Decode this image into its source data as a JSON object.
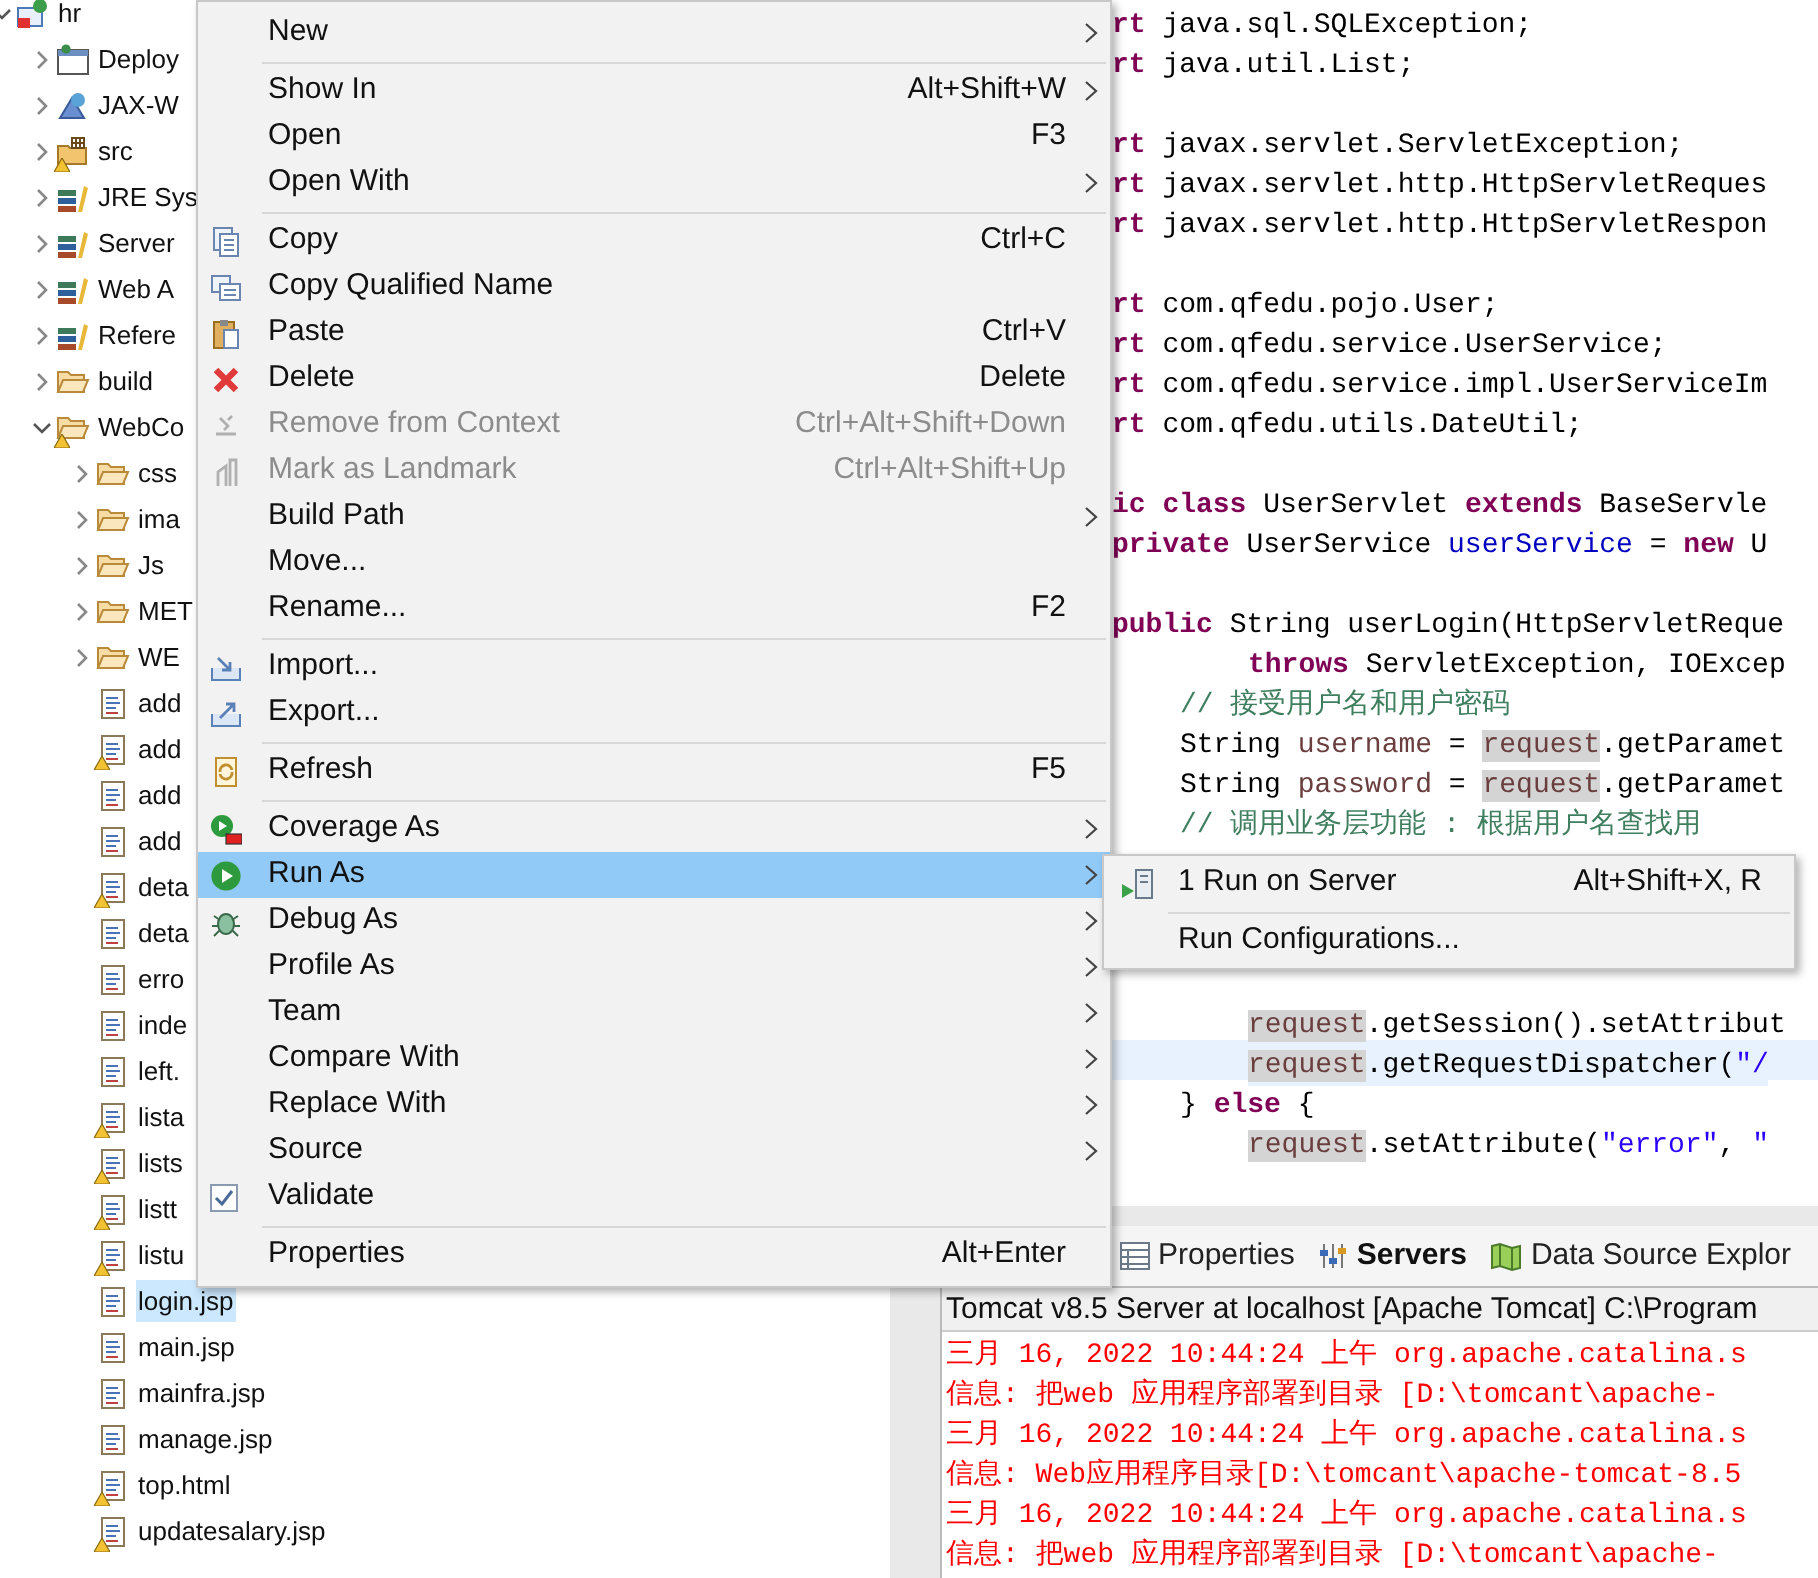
{
  "tree": {
    "items": [
      {
        "label": "hr",
        "kind": "project",
        "expanded": true,
        "selected": false,
        "children": [
          {
            "label": "Deploy",
            "kind": "deploy",
            "expanded": false,
            "selected": false
          },
          {
            "label": "JAX-W",
            "kind": "jaxws",
            "expanded": false,
            "selected": false
          },
          {
            "label": "src",
            "kind": "source-folder",
            "expanded": false,
            "warning": true,
            "selected": false
          },
          {
            "label": "JRE Sys",
            "kind": "library",
            "expanded": false,
            "selected": false
          },
          {
            "label": "Server",
            "kind": "library",
            "expanded": false,
            "selected": false
          },
          {
            "label": "Web A",
            "kind": "library",
            "expanded": false,
            "selected": false
          },
          {
            "label": "Refere",
            "kind": "library",
            "expanded": false,
            "selected": false
          },
          {
            "label": "build",
            "kind": "folder",
            "expanded": false,
            "selected": false
          },
          {
            "label": "WebCo",
            "kind": "folder",
            "expanded": true,
            "warning": true,
            "selected": false,
            "children": [
              {
                "label": "css",
                "kind": "folder",
                "expanded": false,
                "selected": false
              },
              {
                "label": "ima",
                "kind": "folder",
                "expanded": false,
                "selected": false
              },
              {
                "label": "Js",
                "kind": "folder",
                "expanded": false,
                "selected": false
              },
              {
                "label": "MET",
                "kind": "folder",
                "expanded": false,
                "selected": false
              },
              {
                "label": "WE",
                "kind": "folder",
                "expanded": false,
                "selected": false
              },
              {
                "label": "add",
                "kind": "file",
                "selected": false
              },
              {
                "label": "add",
                "kind": "file",
                "warning": true,
                "selected": false
              },
              {
                "label": "add",
                "kind": "file",
                "selected": false
              },
              {
                "label": "add",
                "kind": "file",
                "selected": false
              },
              {
                "label": "deta",
                "kind": "file",
                "warning": true,
                "selected": false
              },
              {
                "label": "deta",
                "kind": "file",
                "selected": false
              },
              {
                "label": "erro",
                "kind": "file",
                "selected": false
              },
              {
                "label": "inde",
                "kind": "file",
                "selected": false
              },
              {
                "label": "left.",
                "kind": "file",
                "selected": false
              },
              {
                "label": "lista",
                "kind": "file",
                "warning": true,
                "selected": false
              },
              {
                "label": "lists",
                "kind": "file",
                "warning": true,
                "selected": false
              },
              {
                "label": "listt",
                "kind": "file",
                "warning": true,
                "selected": false
              },
              {
                "label": "listu",
                "kind": "file",
                "warning": true,
                "selected": false
              },
              {
                "label": "login.jsp",
                "kind": "file",
                "selected": true
              },
              {
                "label": "main.jsp",
                "kind": "file",
                "selected": false
              },
              {
                "label": "mainfra.jsp",
                "kind": "file",
                "selected": false
              },
              {
                "label": "manage.jsp",
                "kind": "file",
                "selected": false
              },
              {
                "label": "top.html",
                "kind": "file",
                "warning": true,
                "selected": false
              },
              {
                "label": "updatesalary.jsp",
                "kind": "file",
                "warning": true,
                "selected": false
              }
            ]
          }
        ]
      }
    ]
  },
  "editor": {
    "lines": [
      {
        "kind": "code0",
        "current": false,
        "segments": [
          {
            "kind": "keyword",
            "text": "rt"
          },
          {
            "kind": "plain",
            "text": " java.sql.SQLException;"
          }
        ]
      },
      {
        "kind": "code0",
        "current": false,
        "segments": [
          {
            "kind": "keyword",
            "text": "rt"
          },
          {
            "kind": "plain",
            "text": " java.util.List;"
          }
        ]
      },
      {
        "kind": "blank"
      },
      {
        "kind": "code0",
        "current": false,
        "segments": [
          {
            "kind": "keyword",
            "text": "rt"
          },
          {
            "kind": "plain",
            "text": " javax.servlet.ServletException;"
          }
        ]
      },
      {
        "kind": "code0",
        "current": false,
        "segments": [
          {
            "kind": "keyword",
            "text": "rt"
          },
          {
            "kind": "plain",
            "text": " javax.servlet.http.HttpServletReques"
          }
        ]
      },
      {
        "kind": "code0",
        "current": false,
        "segments": [
          {
            "kind": "keyword",
            "text": "rt"
          },
          {
            "kind": "plain",
            "text": " javax.servlet.http.HttpServletRespon"
          }
        ]
      },
      {
        "kind": "blank"
      },
      {
        "kind": "code0",
        "current": false,
        "segments": [
          {
            "kind": "keyword",
            "text": "rt"
          },
          {
            "kind": "plain",
            "text": " com.qfedu.pojo.User;"
          }
        ]
      },
      {
        "kind": "code0",
        "current": false,
        "segments": [
          {
            "kind": "keyword",
            "text": "rt"
          },
          {
            "kind": "plain",
            "text": " com.qfedu.service.UserService;"
          }
        ]
      },
      {
        "kind": "code0",
        "current": false,
        "segments": [
          {
            "kind": "keyword",
            "text": "rt"
          },
          {
            "kind": "plain",
            "text": " com.qfedu.service.impl.UserServiceIm"
          }
        ]
      },
      {
        "kind": "code0",
        "current": false,
        "segments": [
          {
            "kind": "keyword",
            "text": "rt"
          },
          {
            "kind": "plain",
            "text": " com.qfedu.utils.DateUtil;"
          }
        ]
      },
      {
        "kind": "blank"
      },
      {
        "kind": "code0",
        "current": false,
        "segments": [
          {
            "kind": "keyword",
            "text": "ic class"
          },
          {
            "kind": "plain",
            "text": " UserServlet "
          },
          {
            "kind": "keyword",
            "text": "extends"
          },
          {
            "kind": "plain",
            "text": " BaseServle"
          }
        ]
      },
      {
        "kind": "code0",
        "current": false,
        "segments": [
          {
            "kind": "keyword",
            "text": "private"
          },
          {
            "kind": "plain",
            "text": " UserService "
          },
          {
            "kind": "field",
            "text": "userService"
          },
          {
            "kind": "plain",
            "text": " = "
          },
          {
            "kind": "keyword",
            "text": "new"
          },
          {
            "kind": "plain",
            "text": " U"
          }
        ]
      },
      {
        "kind": "blank"
      },
      {
        "kind": "code0",
        "current": false,
        "segments": [
          {
            "kind": "keyword",
            "text": "public"
          },
          {
            "kind": "plain",
            "text": " String userLogin(HttpServletReque"
          }
        ]
      },
      {
        "kind": "code2",
        "current": false,
        "segments": [
          {
            "kind": "keyword",
            "text": "throws"
          },
          {
            "kind": "plain",
            "text": " ServletException, IOExcep"
          }
        ]
      },
      {
        "kind": "code1",
        "current": false,
        "segments": [
          {
            "kind": "comment",
            "text": "// 接受用户名和用户密码"
          }
        ]
      },
      {
        "kind": "code1",
        "current": false,
        "segments": [
          {
            "kind": "plain",
            "text": "String "
          },
          {
            "kind": "local",
            "text": "username"
          },
          {
            "kind": "plain",
            "text": " = "
          },
          {
            "kind": "occurrence",
            "text": "request"
          },
          {
            "kind": "plain",
            "text": ".getParamet"
          }
        ]
      },
      {
        "kind": "code1",
        "current": false,
        "segments": [
          {
            "kind": "plain",
            "text": "String "
          },
          {
            "kind": "local",
            "text": "password"
          },
          {
            "kind": "plain",
            "text": " = "
          },
          {
            "kind": "occurrence",
            "text": "request"
          },
          {
            "kind": "plain",
            "text": ".getParamet"
          }
        ]
      },
      {
        "kind": "code1",
        "current": false,
        "segments": [
          {
            "kind": "comment",
            "text": "// 调用业务层功能 : 根据用户名查找用"
          }
        ]
      },
      {
        "kind": "blank"
      },
      {
        "kind": "blank"
      },
      {
        "kind": "blank"
      },
      {
        "kind": "blank"
      },
      {
        "kind": "code2",
        "current": false,
        "segments": [
          {
            "kind": "occurrence",
            "text": "request"
          },
          {
            "kind": "plain",
            "text": ".getSession().setAttribut"
          }
        ]
      },
      {
        "kind": "code2",
        "current": true,
        "segments": [
          {
            "kind": "occurrence",
            "text": "request"
          },
          {
            "kind": "plain",
            "text": ".getRequestDispatcher("
          },
          {
            "kind": "string",
            "text": "\"/"
          }
        ]
      },
      {
        "kind": "code1",
        "current": false,
        "segments": [
          {
            "kind": "plain",
            "text": "} "
          },
          {
            "kind": "keyword",
            "text": "else"
          },
          {
            "kind": "plain",
            "text": " {"
          }
        ]
      },
      {
        "kind": "code2",
        "current": false,
        "segments": [
          {
            "kind": "occurrence",
            "text": "request"
          },
          {
            "kind": "plain",
            "text": ".setAttribute("
          },
          {
            "kind": "string",
            "text": "\"error\""
          },
          {
            "kind": "plain",
            "text": ", "
          },
          {
            "kind": "string",
            "text": "\""
          }
        ]
      }
    ]
  },
  "bottom_panel": {
    "tabs": [
      {
        "label": "Properties",
        "kind": "table",
        "selected": false
      },
      {
        "label": "Servers",
        "kind": "servers",
        "selected": true
      },
      {
        "label": "Data Source Explor",
        "kind": "datasource",
        "selected": false
      }
    ],
    "console_title": "Tomcat v8.5 Server at localhost [Apache Tomcat] C:\\Program",
    "console_lines": [
      "三月 16, 2022 10:44:24 上午 org.apache.catalina.s",
      "信息: 把web 应用程序部署到目录 [D:\\tomcant\\apache-",
      "三月 16, 2022 10:44:24 上午 org.apache.catalina.s",
      "信息: Web应用程序目录[D:\\tomcant\\apache-tomcat-8.5",
      "三月 16, 2022 10:44:24 上午 org.apache.catalina.s",
      "信息: 把web 应用程序部署到目录 [D:\\tomcant\\apache-"
    ]
  },
  "context_menu": {
    "items": [
      {
        "kind": "plain",
        "label": "New",
        "submenu": true,
        "disabled": false,
        "selected": false
      },
      {
        "kind": "separator"
      },
      {
        "kind": "plain",
        "label": "Show In",
        "shortcut": "Alt+Shift+W",
        "submenu": true,
        "disabled": false,
        "selected": false
      },
      {
        "kind": "plain",
        "label": "Open",
        "shortcut": "F3",
        "submenu": false,
        "disabled": false,
        "selected": false
      },
      {
        "kind": "plain",
        "label": "Open With",
        "submenu": true,
        "disabled": false,
        "selected": false
      },
      {
        "kind": "separator"
      },
      {
        "kind": "copy",
        "label": "Copy",
        "shortcut": "Ctrl+C",
        "submenu": false,
        "disabled": false,
        "selected": false
      },
      {
        "kind": "copy-qualified",
        "label": "Copy Qualified Name",
        "submenu": false,
        "disabled": false,
        "selected": false
      },
      {
        "kind": "paste",
        "label": "Paste",
        "shortcut": "Ctrl+V",
        "submenu": false,
        "disabled": false,
        "selected": false
      },
      {
        "kind": "delete",
        "label": "Delete",
        "shortcut": "Delete",
        "submenu": false,
        "disabled": false,
        "selected": false
      },
      {
        "kind": "remove-context",
        "label": "Remove from Context",
        "shortcut": "Ctrl+Alt+Shift+Down",
        "submenu": false,
        "disabled": true,
        "selected": false
      },
      {
        "kind": "landmark",
        "label": "Mark as Landmark",
        "shortcut": "Ctrl+Alt+Shift+Up",
        "submenu": false,
        "disabled": true,
        "selected": false
      },
      {
        "kind": "plain",
        "label": "Build Path",
        "submenu": true,
        "disabled": false,
        "selected": false
      },
      {
        "kind": "plain",
        "label": "Move...",
        "submenu": false,
        "disabled": false,
        "selected": false
      },
      {
        "kind": "plain",
        "label": "Rename...",
        "shortcut": "F2",
        "submenu": false,
        "disabled": false,
        "selected": false
      },
      {
        "kind": "separator"
      },
      {
        "kind": "import",
        "label": "Import...",
        "submenu": false,
        "disabled": false,
        "selected": false
      },
      {
        "kind": "export",
        "label": "Export...",
        "submenu": false,
        "disabled": false,
        "selected": false
      },
      {
        "kind": "separator"
      },
      {
        "kind": "refresh",
        "label": "Refresh",
        "shortcut": "F5",
        "submenu": false,
        "disabled": false,
        "selected": false
      },
      {
        "kind": "separator"
      },
      {
        "kind": "coverage",
        "label": "Coverage As",
        "submenu": true,
        "disabled": false,
        "selected": false
      },
      {
        "kind": "run",
        "label": "Run As",
        "submenu": true,
        "disabled": false,
        "selected": true
      },
      {
        "kind": "debug",
        "label": "Debug As",
        "submenu": true,
        "disabled": false,
        "selected": false
      },
      {
        "kind": "plain",
        "label": "Profile As",
        "submenu": true,
        "disabled": false,
        "selected": false
      },
      {
        "kind": "plain",
        "label": "Team",
        "submenu": true,
        "disabled": false,
        "selected": false
      },
      {
        "kind": "plain",
        "label": "Compare With",
        "submenu": true,
        "disabled": false,
        "selected": false
      },
      {
        "kind": "plain",
        "label": "Replace With",
        "submenu": true,
        "disabled": false,
        "selected": false
      },
      {
        "kind": "plain",
        "label": "Source",
        "submenu": true,
        "disabled": false,
        "selected": false
      },
      {
        "kind": "check",
        "label": "Validate",
        "submenu": false,
        "disabled": false,
        "selected": false
      },
      {
        "kind": "separator"
      },
      {
        "kind": "plain",
        "label": "Properties",
        "shortcut": "Alt+Enter",
        "submenu": false,
        "disabled": false,
        "selected": false
      }
    ]
  },
  "submenu": {
    "items": [
      {
        "kind": "server-run",
        "label": "1 Run on Server",
        "shortcut": "Alt+Shift+X, R"
      },
      {
        "kind": "separator"
      },
      {
        "kind": "plain",
        "label": "Run Configurations..."
      }
    ]
  }
}
